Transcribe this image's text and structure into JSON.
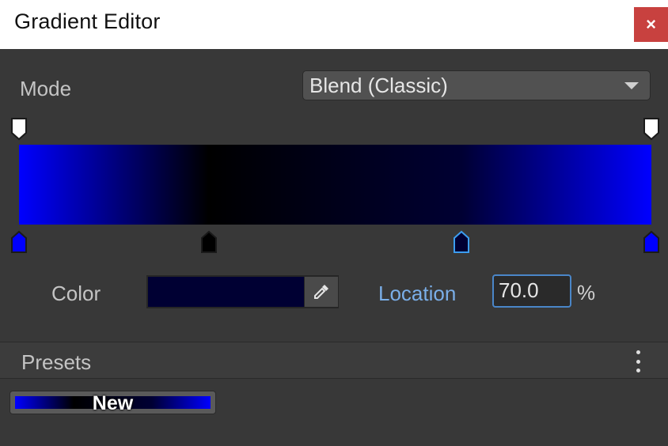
{
  "window": {
    "title": "Gradient Editor",
    "close_label": "×"
  },
  "mode": {
    "label": "Mode",
    "value": "Blend (Classic)"
  },
  "gradient": {
    "color_keys": [
      {
        "color": "#0000ff",
        "location_percent": 0,
        "selected": false
      },
      {
        "color": "#000000",
        "location_percent": 30,
        "selected": false
      },
      {
        "color": "#000033",
        "location_percent": 70,
        "selected": true
      },
      {
        "color": "#0000ff",
        "location_percent": 100,
        "selected": false
      }
    ],
    "alpha_keys": [
      {
        "alpha": 255,
        "location_percent": 0
      },
      {
        "alpha": 255,
        "location_percent": 100
      }
    ]
  },
  "selected_key": {
    "color_label": "Color",
    "color": "#000033",
    "location_label": "Location",
    "location_value": "70.0",
    "unit": "%"
  },
  "presets": {
    "header": "Presets",
    "items": [
      {
        "label": "New"
      }
    ]
  },
  "colors": {
    "accent": "#4a86c8",
    "selected_marker_outline": "#3c9df0",
    "close_button": "#c8413f"
  },
  "icons": {
    "close": "close-icon",
    "dropdown": "chevron-down-icon",
    "eyedropper": "eyedropper-icon",
    "menu": "kebab-menu-icon"
  }
}
